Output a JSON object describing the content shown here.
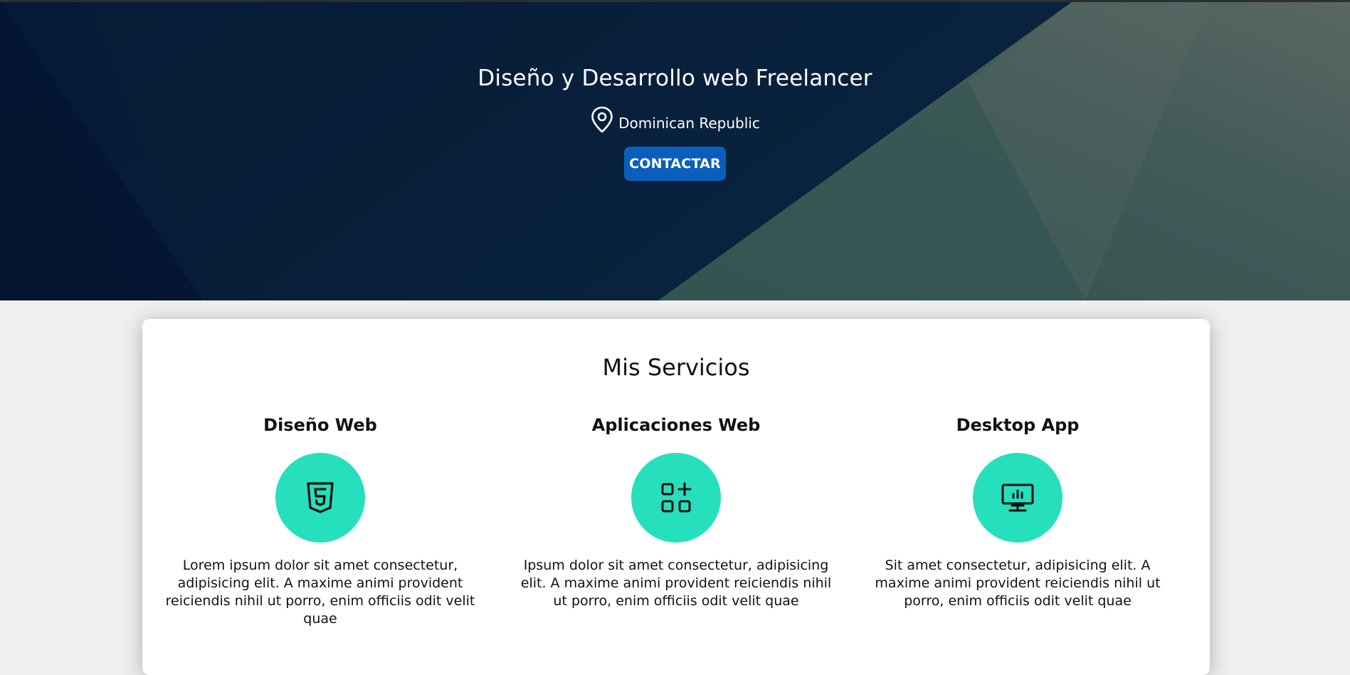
{
  "hero": {
    "title": "Diseño y Desarrollo web Freelancer",
    "location": "Dominican Republic",
    "location_icon": "map-pin-icon",
    "contact_label": "CONTACTAR"
  },
  "services": {
    "title": "Mis Servicios",
    "items": [
      {
        "name": "Diseño Web",
        "icon": "html5-icon",
        "description": "Lorem ipsum dolor sit amet consectetur, adipisicing elit. A maxime animi provident reiciendis nihil ut porro, enim officiis odit velit quae"
      },
      {
        "name": "Aplicaciones Web",
        "icon": "apps-add-icon",
        "description": "Ipsum dolor sit amet consectetur, adipisicing elit. A maxime animi provident reiciendis nihil ut porro, enim officiis odit velit quae"
      },
      {
        "name": "Desktop App",
        "icon": "desktop-monitor-icon",
        "description": "Sit amet consectetur, adipisicing elit. A maxime animi provident reiciendis nihil ut porro, enim officiis odit velit quae"
      }
    ]
  },
  "colors": {
    "hero_navy": "#0a223f",
    "hero_teal": "#4f6461",
    "accent_button": "#0a5fbd",
    "icon_circle": "#26e0bd",
    "page_bg": "#efefef"
  }
}
